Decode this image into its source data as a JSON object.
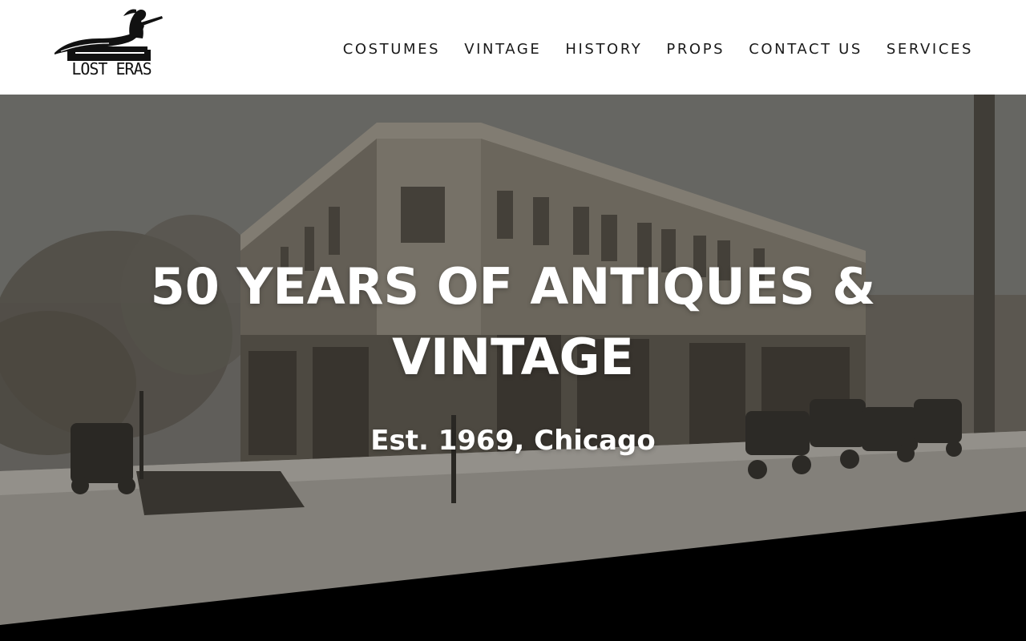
{
  "brand": {
    "logo_text": "LOST ERAS",
    "logo_icon": "reclining-figure-logo-icon"
  },
  "nav": {
    "items": [
      {
        "label": "COSTUMES"
      },
      {
        "label": "VINTAGE"
      },
      {
        "label": "HISTORY"
      },
      {
        "label": "PROPS"
      },
      {
        "label": "CONTACT US"
      },
      {
        "label": "SERVICES"
      }
    ]
  },
  "hero": {
    "title": "50 YEARS OF ANTIQUES & VINTAGE",
    "subtitle": "Est. 1969, Chicago",
    "background": "sepia-historic-street-corner-photo"
  },
  "colors": {
    "header_bg": "#ffffff",
    "nav_text": "#1a1a1a",
    "hero_text": "#ffffff",
    "band": "#000000"
  }
}
